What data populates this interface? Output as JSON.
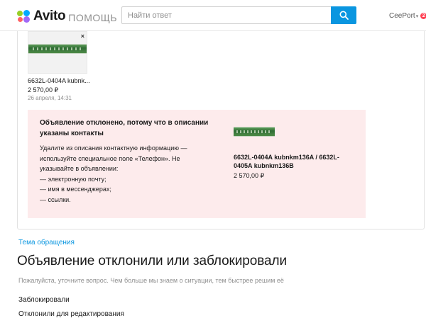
{
  "header": {
    "logo_text": "Avito",
    "logo_subtitle": "ПОМОЩЬ",
    "search_placeholder": "Найти ответ",
    "user_name": "CeePort",
    "user_arrow": "▾",
    "notification_count": "2",
    "accent_color": "#0a96e0",
    "search_icon": "search-icon"
  },
  "attachment": {
    "close_symbol": "×",
    "title": "6632L-0404A kubnk...",
    "price": "2 570,00 ₽",
    "date": "26 апреля, 14:31"
  },
  "rejection": {
    "title": "Объявление отклонено, потому что в описании указаны контакты",
    "lines": [
      "Удалите из описания контактную информацию —",
      "используйте специальное поле «Телефон». Не",
      "указывайте в объявлении:",
      "— электронную почту;",
      "— имя в мессенджерах;",
      "— ссылки."
    ],
    "ad_title": "6632L-0404A kubnkm136A / 6632L-0405A kubnkm136B",
    "ad_price": "2 570,00 ₽",
    "background_color": "#fdebec"
  },
  "form": {
    "topic_label": "Тема обращения",
    "heading": "Объявление отклонили или заблокировали",
    "hint": "Пожалуйста, уточните вопрос. Чем больше мы знаем о ситуации, тем быстрее решим её",
    "options": [
      "Заблокировали",
      "Отклонили для редактирования"
    ]
  }
}
